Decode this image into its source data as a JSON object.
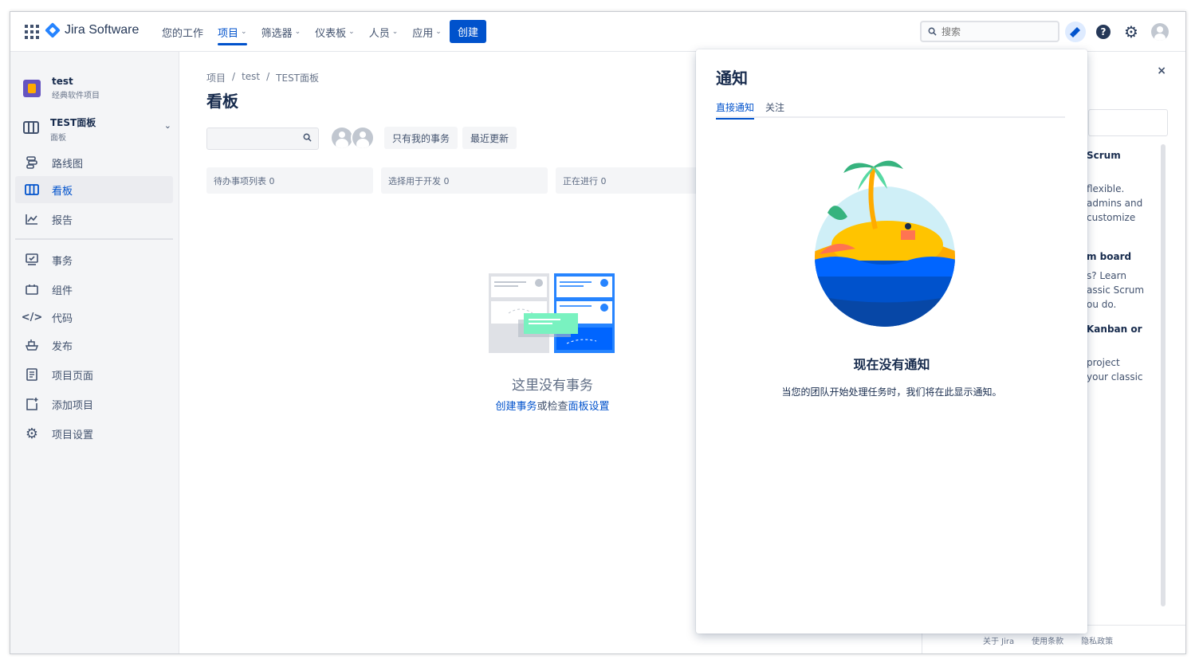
{
  "topnav": {
    "logo_text": "Jira Software",
    "items": [
      {
        "label": "您的工作",
        "chevron": false
      },
      {
        "label": "项目",
        "chevron": true,
        "active": true
      },
      {
        "label": "筛选器",
        "chevron": true
      },
      {
        "label": "仪表板",
        "chevron": true
      },
      {
        "label": "人员",
        "chevron": true
      },
      {
        "label": "应用",
        "chevron": true
      }
    ],
    "create_label": "创建",
    "search_placeholder": "搜索",
    "accent_color": "#0052cc"
  },
  "sidebar": {
    "project": {
      "name": "test",
      "type": "经典软件项目"
    },
    "board": {
      "name": "TEST面板",
      "sub": "面板"
    },
    "items": [
      {
        "label": "路线图",
        "icon": "roadmap-icon"
      },
      {
        "label": "看板",
        "icon": "board-icon",
        "active": true
      },
      {
        "label": "报告",
        "icon": "reports-icon"
      },
      {
        "label": "事务",
        "icon": "issues-icon"
      },
      {
        "label": "组件",
        "icon": "components-icon"
      },
      {
        "label": "代码",
        "icon": "code-icon"
      },
      {
        "label": "发布",
        "icon": "release-icon"
      },
      {
        "label": "项目页面",
        "icon": "project-pages-icon"
      },
      {
        "label": "添加项目",
        "icon": "add-item-icon"
      },
      {
        "label": "项目设置",
        "icon": "settings-icon"
      }
    ]
  },
  "main": {
    "breadcrumb": [
      "项目",
      "/",
      "test",
      "/",
      "TEST面板"
    ],
    "title": "看板",
    "filters": [
      "只有我的事务",
      "最近更新"
    ],
    "columns": [
      "待办事项列表 0",
      "选择用于开发 0",
      "正在进行 0"
    ],
    "empty_title": "这里没有事务",
    "empty_link1": "创建事务",
    "empty_mid": "或检查",
    "empty_link2": "面板设置"
  },
  "right_panel": {
    "close": "×",
    "lines": [
      {
        "text": "Scrum",
        "bold": true
      },
      {
        "text": "flexible.",
        "bold": false
      },
      {
        "text": "admins and",
        "bold": false
      },
      {
        "text": "customize",
        "bold": false
      },
      {
        "text": "m board",
        "bold": true
      },
      {
        "text": "s? Learn",
        "bold": false
      },
      {
        "text": "assic Scrum",
        "bold": false
      },
      {
        "text": "ou do.",
        "bold": false
      },
      {
        "text": "Kanban or",
        "bold": true
      },
      {
        "text": "project",
        "bold": false
      },
      {
        "text": "your classic",
        "bold": false
      }
    ],
    "footer": [
      "关于 Jira",
      "使用条款",
      "隐私政策"
    ]
  },
  "notifications": {
    "title": "通知",
    "tabs": [
      {
        "label": "直接通知",
        "active": true
      },
      {
        "label": "关注",
        "active": false
      }
    ],
    "empty_title": "现在没有通知",
    "empty_sub": "当您的团队开始处理任务时，我们将在此显示通知。"
  }
}
